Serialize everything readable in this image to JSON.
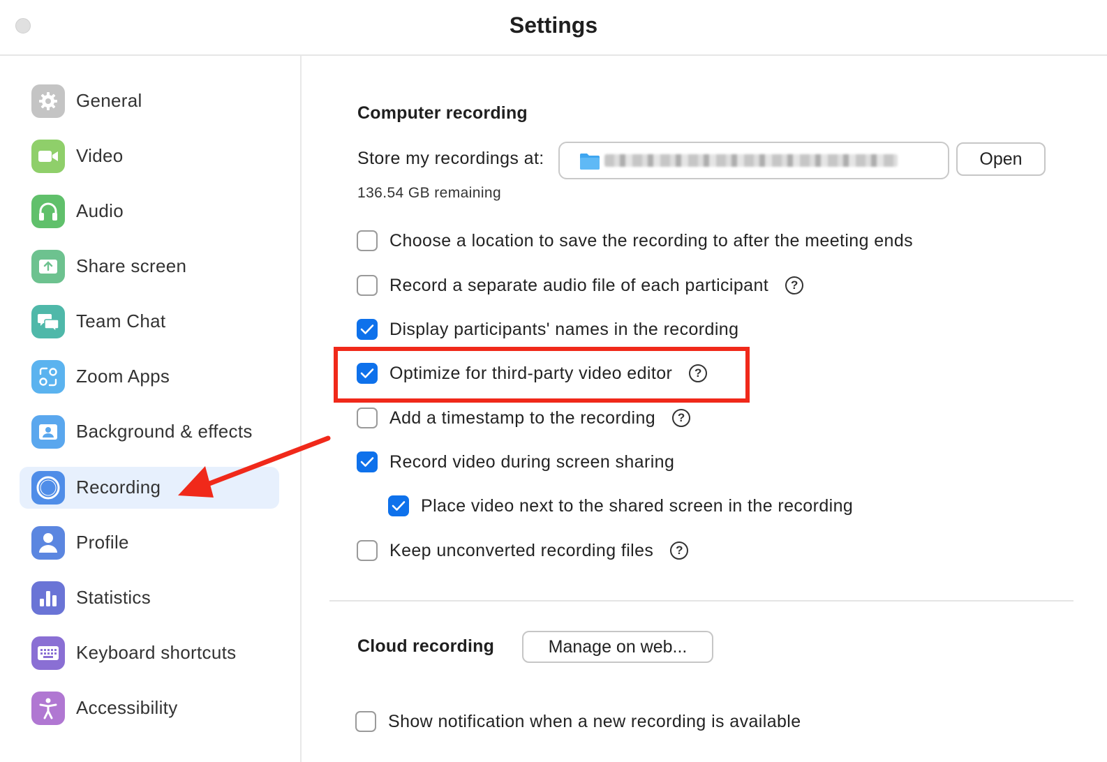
{
  "window": {
    "title": "Settings"
  },
  "sidebar": {
    "items": [
      {
        "label": "General",
        "icon": "gear-icon",
        "color": "#b9b9b9",
        "active": false
      },
      {
        "label": "Video",
        "icon": "video-camera-icon",
        "color": "#8fcf6a",
        "active": false
      },
      {
        "label": "Audio",
        "icon": "headphones-icon",
        "color": "#60c06b",
        "active": false
      },
      {
        "label": "Share screen",
        "icon": "share-screen-icon",
        "color": "#6dc28f",
        "active": false
      },
      {
        "label": "Team Chat",
        "icon": "chat-bubbles-icon",
        "color": "#4fb8a9",
        "active": false
      },
      {
        "label": "Zoom Apps",
        "icon": "zoom-apps-icon",
        "color": "#5bb3ef",
        "active": false
      },
      {
        "label": "Background & effects",
        "icon": "background-portrait-icon",
        "color": "#5aa7ee",
        "active": false
      },
      {
        "label": "Recording",
        "icon": "record-circle-icon",
        "color": "#4f8de8",
        "active": true
      },
      {
        "label": "Profile",
        "icon": "person-icon",
        "color": "#5b86e0",
        "active": false
      },
      {
        "label": "Statistics",
        "icon": "bar-chart-icon",
        "color": "#6a74d6",
        "active": false
      },
      {
        "label": "Keyboard shortcuts",
        "icon": "keyboard-icon",
        "color": "#8a6fd4",
        "active": false
      },
      {
        "label": "Accessibility",
        "icon": "accessibility-icon",
        "color": "#b077d2",
        "active": false
      }
    ]
  },
  "computer_recording": {
    "title": "Computer recording",
    "store_label": "Store my recordings at:",
    "open_button": "Open",
    "remaining": "136.54 GB remaining",
    "options": [
      {
        "label": "Choose a location to save the recording to after the meeting ends",
        "checked": false,
        "help": false
      },
      {
        "label": "Record a separate audio file of each participant",
        "checked": false,
        "help": true
      },
      {
        "label": "Display participants' names in the recording",
        "checked": true,
        "help": false
      },
      {
        "label": "Optimize for third-party video editor",
        "checked": true,
        "help": true
      },
      {
        "label": "Add a timestamp to the recording",
        "checked": false,
        "help": true
      },
      {
        "label": "Record video during screen sharing",
        "checked": true,
        "help": false
      },
      {
        "label": "Place video next to the shared screen in the recording",
        "checked": true,
        "help": false
      },
      {
        "label": "Keep unconverted recording files",
        "checked": false,
        "help": true
      }
    ]
  },
  "cloud_recording": {
    "title": "Cloud recording",
    "manage_button": "Manage on web...",
    "options": [
      {
        "label": "Show notification when a new recording is available",
        "checked": false
      }
    ]
  },
  "help_glyph": "?",
  "accent_color": "#0e71eb",
  "annotation_color": "#f0291a"
}
